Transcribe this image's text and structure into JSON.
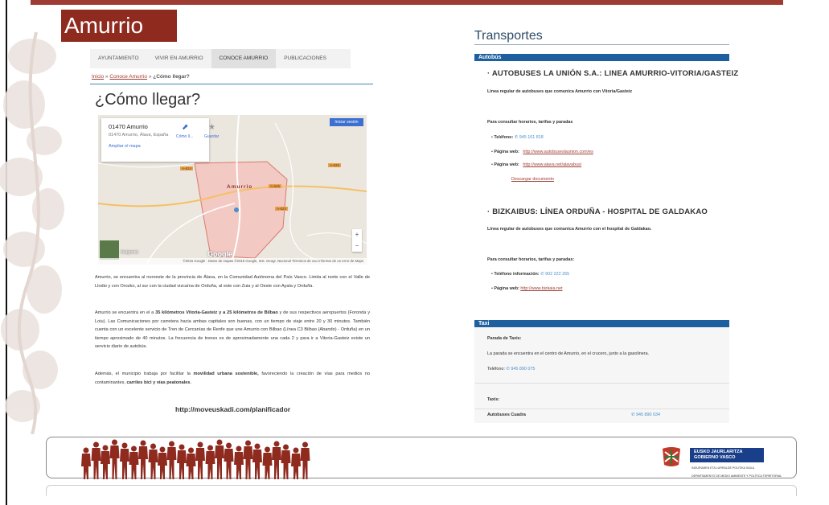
{
  "slide": {
    "title": "Amurrio"
  },
  "left_page": {
    "nav": [
      "AYUNTAMIENTO",
      "VIVIR EN AMURRIO",
      "CONOCE AMURRIO",
      "PUBLICACIONES"
    ],
    "breadcrumb": {
      "home": "Inicio",
      "sep1": " » ",
      "section": "Conoce Amurrio",
      "sep2": " » ",
      "current": "¿Cómo llegar?"
    },
    "heading": "¿Cómo llegar?",
    "map": {
      "place_title": "01470 Amurrio",
      "place_address": "01470 Amurrio, Álava, España",
      "enlarge_link": "Ampliar el mapa",
      "directions_label": "Cómo ll...",
      "save_label": "Guardar",
      "signin_label": "Iniciar sesión",
      "town_label": "Amurrio",
      "roads": [
        "A-624",
        "A-625",
        "A-624",
        "A-625"
      ],
      "satellite_label": "Imágenes",
      "google_logo": "Google",
      "footer": "©2015 Google · Datos de mapas ©2015 Google, Inst. Geogr. Nacional    Términos de uso    Informar de un error de Maps",
      "zoom_in": "+",
      "zoom_out": "−"
    },
    "paragraph1": "Amurrio, se encuentra al noroeste de la provincia de Álava, en la Comunidad Autónoma del País Vasco. Limita al norte con el Valle de Llodio y con Orozko, al sur con la ciudad vizcaína de Orduña, al este con Zuia y al Oeste con Ayala y Orduña.",
    "paragraph2_pre": "Amurrio se encuentra en el a ",
    "paragraph2_bold": "35 kilómetros Vitoria-Gasteiz y a 25 kilómetros de Bilbao",
    "paragraph2_post": " y de sus respectivos aeropuertos (Foronda y Loiu). Las Comunicaciones por carretera hacia ambas capitales son buenas, con un tiempo de viaje entre 20 y 30 minutos. También cuenta con un excelente servicio de Tren de Cercanías de Renfe que une Amurrio con Bilbao (Línea C3 Bilbao (Abando) - Orduña) en un tiempo aproximado de 40 minutos. La frecuencia de trenes es de aproximadamente una cada 2 y para ir a Vitoria-Gasteiz existe un servicio diario de autobús.",
    "paragraph3_pre": "Además, el municipio trabaja por facilitar la ",
    "paragraph3_bold1": "movilidad urbana sostenible,",
    "paragraph3_mid": " favoreciendo la creación de vías para medios no contaminantes, ",
    "paragraph3_bold2": "carriles bici y vías peatonales",
    "paragraph3_end": ".",
    "planner_link": "http://moveuskadi.com/planificador"
  },
  "right_page": {
    "title": "Transportes",
    "bus_section": "Autobús",
    "bus1": {
      "heading": "AUTOBUSES LA UNIÓN S.A.: LINEA AMURRIO-VITORIA/GASTEIZ",
      "desc": "Línea regular de autobuses que comunica Amurrio con Vitoria/Gasteiz",
      "consult": "Para consultar horarios, tarifas y paradas",
      "phone_label": "Teléfono:",
      "phone": "945 161 818",
      "web1_label": "Página web:",
      "web1": "http://www.autobuseslaunion.com/es",
      "web2_label": "Página web:",
      "web2": "http://www.alava.net/alavabus/",
      "download": "Descargar documento"
    },
    "bus2": {
      "heading": "BIZKAIBUS: LÍNEA ORDUÑA - HOSPITAL DE GALDAKAO",
      "desc": "Línea regular de autobuses que comunica Amurrio con el hospital de Galdakao.",
      "consult": "Para consultar horarios, tarifas y paradas:",
      "phone_label": "Teléfono información:",
      "phone": "902 222 265",
      "web_label": "Página web:",
      "web": "http://www.bizkaia.net"
    },
    "taxi_section": "Taxi",
    "taxi": {
      "stop_title": "Parada de Taxis:",
      "stop_desc": "La parada se encuentra en el centro de Amurrio, en el crucero, junto a la gasolinera.",
      "phone_label": "Teléfono:",
      "phone": "945 890 075",
      "taxis_title": "Taxis:",
      "company": "Autobuses Cuadra",
      "company_phone": "945 890 034"
    }
  },
  "footer": {
    "gov_name_line1": "EUSKO JAURLARITZA",
    "gov_name_line2": "GOBIERNO VASCO",
    "dept1": "INGURUMEN ETA LURRALDE POLITIKA SAILA",
    "dept2": "DEPARTAMENTO DE MEDIO AMBIENTE Y POLÍTICA TERRITORIAL"
  },
  "colors": {
    "brand_red": "#8f2a1f",
    "section_blue": "#1e5fa0",
    "title_blue": "#2d4b66"
  }
}
